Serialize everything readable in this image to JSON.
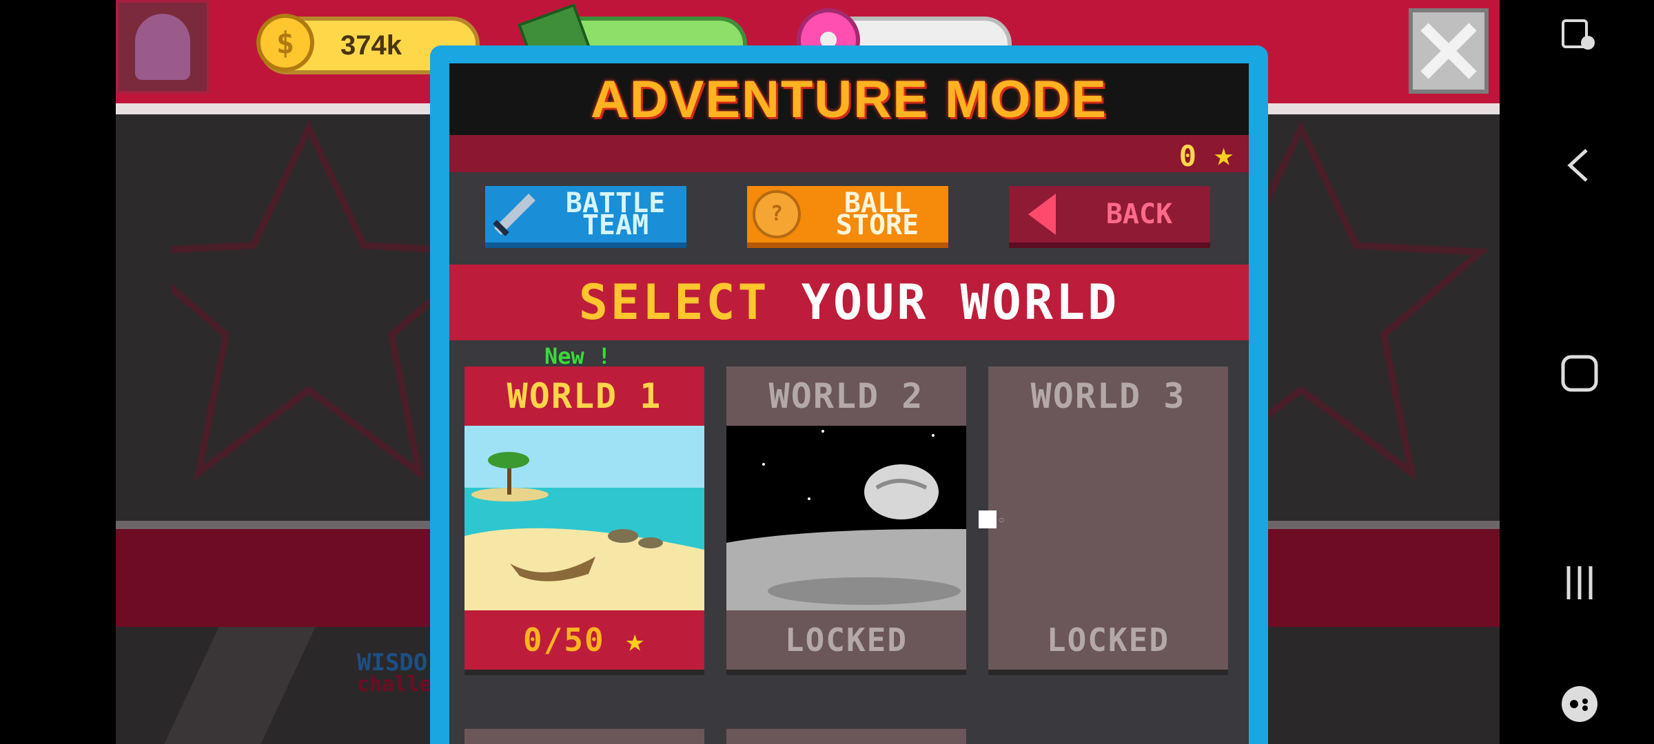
{
  "hud": {
    "coins": "374k",
    "cash": "",
    "donuts": "",
    "close_icon": "close-icon"
  },
  "modal": {
    "title": "ADVENTURE MODE",
    "stars": "0",
    "buttons": {
      "battle_team": "BATTLE TEAM",
      "ball_store": "BALL STORE",
      "back": "BACK"
    },
    "select_a": "SELECT",
    "select_b": "YOUR WORLD",
    "new_tag": "New !",
    "worlds": [
      {
        "name": "WORLD 1",
        "status": "0/50",
        "locked": false
      },
      {
        "name": "WORLD 2",
        "status": "LOCKED",
        "locked": true
      },
      {
        "name": "WORLD 3",
        "status": "LOCKED",
        "locked": true
      }
    ]
  },
  "background_text": {
    "wisdom": "WISDO",
    "challenge": "challe"
  },
  "colors": {
    "modal_border": "#1aa6e0",
    "banner_red": "#bd1d3a",
    "gold": "#ffc62e",
    "locked_gray": "#6b5759"
  }
}
